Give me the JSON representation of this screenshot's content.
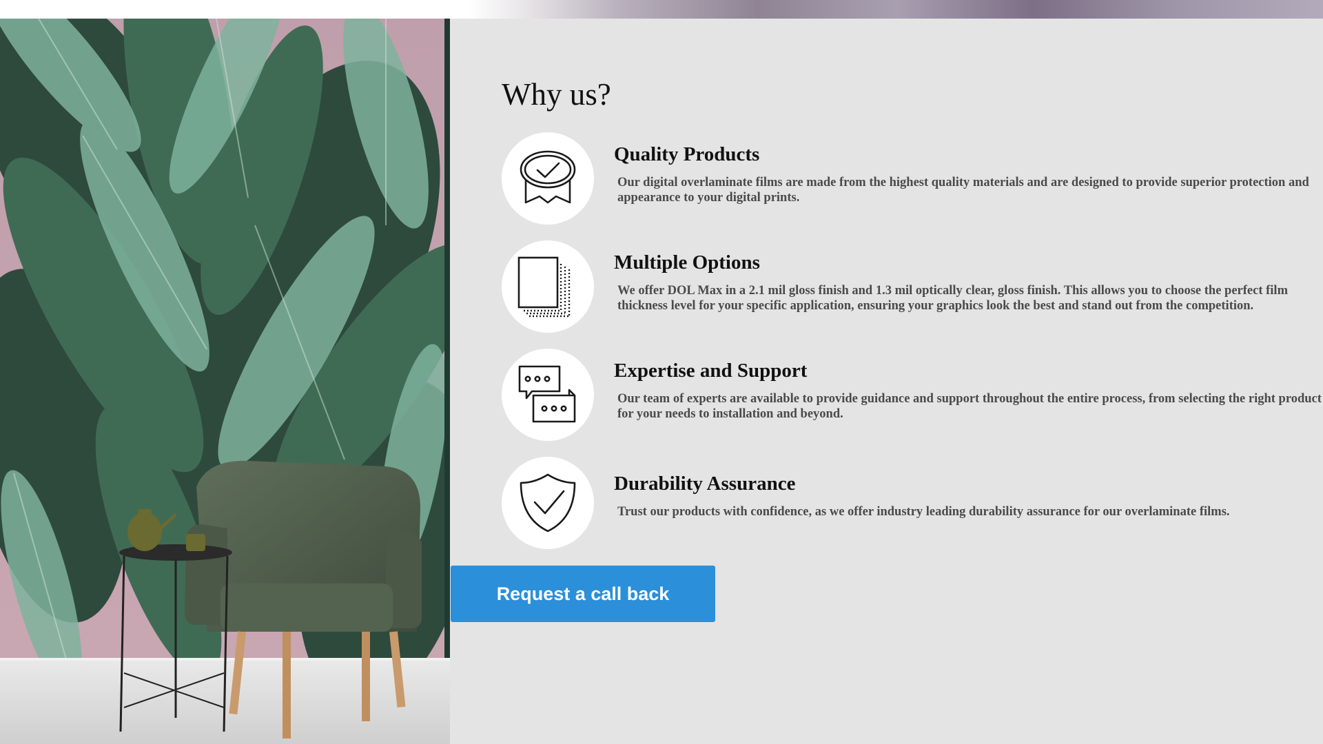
{
  "section": {
    "title": "Why us?"
  },
  "features": [
    {
      "icon": "quality-badge-icon",
      "title": "Quality Products",
      "description": "Our digital overlaminate films are made from the highest quality materials and are designed to provide superior protection and appearance to your digital prints."
    },
    {
      "icon": "stacked-pages-icon",
      "title": "Multiple Options",
      "description": "We offer DOL Max in a 2.1 mil gloss finish and 1.3 mil optically clear, gloss finish. This allows you to choose the perfect film thickness level for your specific application, ensuring your graphics look the best and stand out from the competition."
    },
    {
      "icon": "chat-bubbles-icon",
      "title": "Expertise and Support",
      "description": "Our team of experts are available to provide guidance and support throughout the entire process, from selecting the right product for your needs to installation and beyond."
    },
    {
      "icon": "shield-check-icon",
      "title": "Durability Assurance",
      "description": "Trust our products with confidence, as we offer industry leading durability assurance for our overlaminate films."
    }
  ],
  "cta": {
    "label": "Request a call back"
  },
  "colors": {
    "panel_background": "#e4e4e4",
    "button_background": "#2b8fda",
    "button_text": "#ffffff",
    "wall_pink": "#b99aa6",
    "leaf_green": "#4f8a6f"
  }
}
